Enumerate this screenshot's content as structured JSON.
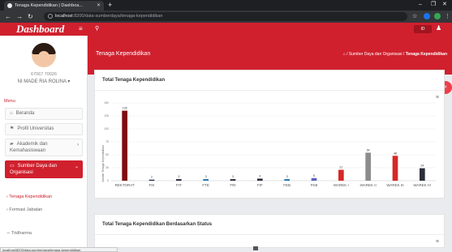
{
  "browser": {
    "tab_title": "Tenaga Kependidikan | Dashboa...",
    "tab_close": "✕",
    "new_tab": "+",
    "minimize": "–",
    "restore": "❐",
    "url_host": "localhost",
    "url_path": ":8200/data-sumberdaya/tenaga-kependidikan",
    "status_url": "localhost/8200/data-sumberdaya/tenaga-kependidikan"
  },
  "header": {
    "logo": "Dashboard",
    "menu_icon": "≡",
    "search_icon": "⚲",
    "flag_label": "ID",
    "user_icon": "♟"
  },
  "sidebar": {
    "user_id": "67067 70026",
    "user_name": "NI MADE RIA ROLINA ▾",
    "menu_heading": "Menu",
    "items": [
      {
        "icon": "⌂",
        "label": "Beranda"
      },
      {
        "icon": "⚑",
        "label": "Profil Universitas"
      },
      {
        "icon": "▰",
        "label": "Akademik dan",
        "label2": "Kemahasiswaan",
        "chevron": "›"
      },
      {
        "icon": "▭",
        "label": "Sumber Daya dan",
        "label2": "Organisasi",
        "chevron": "⌄"
      }
    ],
    "subitems": [
      {
        "label": "› Tenaga Kependidikan"
      },
      {
        "label": "› Formasi Jabatan"
      }
    ],
    "next_item": "∼ Tridharma"
  },
  "page": {
    "title": "Tenaga Kependidikan",
    "breadcrumb_home": "⌂",
    "breadcrumb_mid": "/ Sumber Daya dan Organisasi /",
    "breadcrumb_current": "Tenaga Kependidikan",
    "collapse_icon": "«"
  },
  "card1": {
    "title": "Total Tenaga Kependidikan",
    "menu_icon": "≡"
  },
  "card2": {
    "title": "Total Tenaga Kependidikan Berdasarkan Status",
    "menu_icon": "≡"
  },
  "chart_data": {
    "type": "bar",
    "title": "Total Tenaga Kependidikan",
    "ylabel": "Jumlah Tenaga Kependidikan",
    "ylim": [
      0,
      150
    ],
    "yticks": [
      0,
      25,
      50,
      75,
      100,
      125,
      150
    ],
    "grid": true,
    "categories": [
      "REKTORAT",
      "FIK",
      "FIT",
      "FTE",
      "FRI",
      "FIF",
      "FEB",
      "FKB",
      "WAREK I",
      "WAREK II",
      "WAREK III",
      "WAREK IV"
    ],
    "values": [
      135,
      2,
      3,
      3,
      3,
      4,
      3,
      5,
      21,
      54,
      48,
      24
    ],
    "colors": [
      "#7f0b12",
      "#1f2a44",
      "#2a2f3a",
      "#1f77b4",
      "#2b2f3a",
      "#2b2f3a",
      "#1f77b4",
      "#5b5fc7",
      "#d62728",
      "#8c8c8c",
      "#d62728",
      "#2b2f3a"
    ]
  }
}
